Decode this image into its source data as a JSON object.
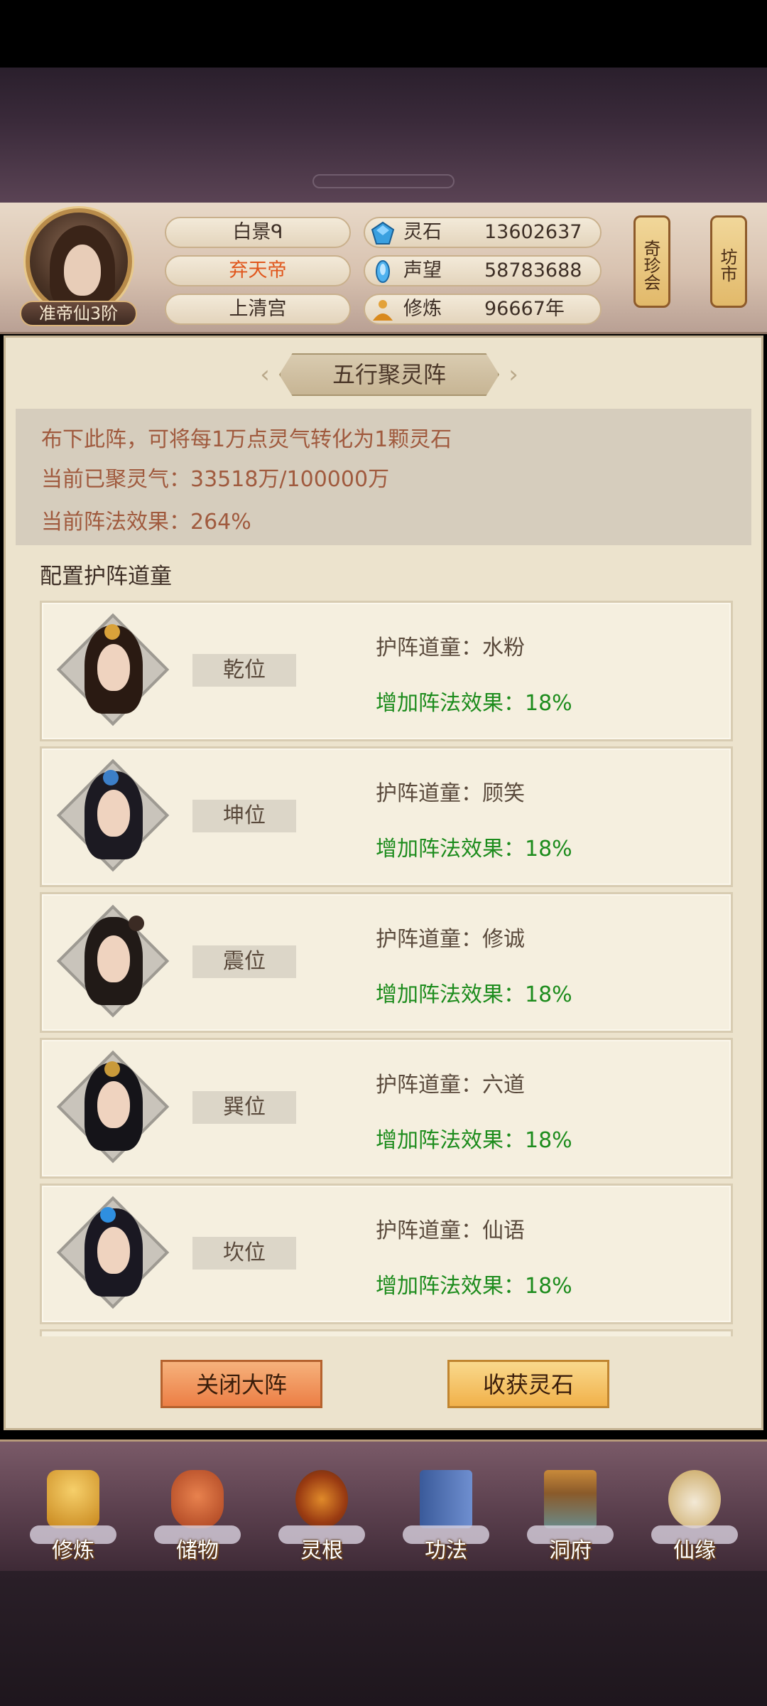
{
  "player": {
    "rank": "准帝仙3阶",
    "name": "白景ᑫ",
    "title": "弃天帝",
    "sect": "上清宫"
  },
  "resources": [
    {
      "icon": "spirit-stone-icon",
      "label": "灵石",
      "value": "13602637"
    },
    {
      "icon": "reputation-icon",
      "label": "声望",
      "value": "58783688"
    },
    {
      "icon": "cultivation-icon",
      "label": "修炼",
      "value": "96667年"
    }
  ],
  "side_buttons": {
    "treasure": "奇珍会",
    "market": "坊市"
  },
  "panel": {
    "title": "五行聚灵阵",
    "desc": "布下此阵，可将每1万点灵气转化为1颗灵石",
    "gathered": "当前已聚灵气：33518万/100000万",
    "effect": "当前阵法效果：264%",
    "section_label": "配置护阵道童"
  },
  "cards": [
    {
      "position": "乾位",
      "name": "护阵道童：水粉",
      "effect": "增加阵法效果：18%"
    },
    {
      "position": "坤位",
      "name": "护阵道童：顾笑",
      "effect": "增加阵法效果：18%"
    },
    {
      "position": "震位",
      "name": "护阵道童：修诚",
      "effect": "增加阵法效果：18%"
    },
    {
      "position": "巽位",
      "name": "护阵道童：六道",
      "effect": "增加阵法效果：18%"
    },
    {
      "position": "坎位",
      "name": "护阵道童：仙语",
      "effect": "增加阵法效果：18%"
    }
  ],
  "actions": {
    "close": "关闭大阵",
    "harvest": "收获灵石"
  },
  "nav": [
    {
      "label": "修炼",
      "icon": "cultivate-icon"
    },
    {
      "label": "储物",
      "icon": "storage-bag-icon"
    },
    {
      "label": "灵根",
      "icon": "spirit-root-icon"
    },
    {
      "label": "功法",
      "icon": "technique-book-icon"
    },
    {
      "label": "洞府",
      "icon": "cave-mansion-icon"
    },
    {
      "label": "仙缘",
      "icon": "fortune-icon"
    }
  ],
  "colors": {
    "effect_green": "#1d8c1d",
    "info_text": "#a05a3e",
    "title_orange": "#e0561c"
  }
}
